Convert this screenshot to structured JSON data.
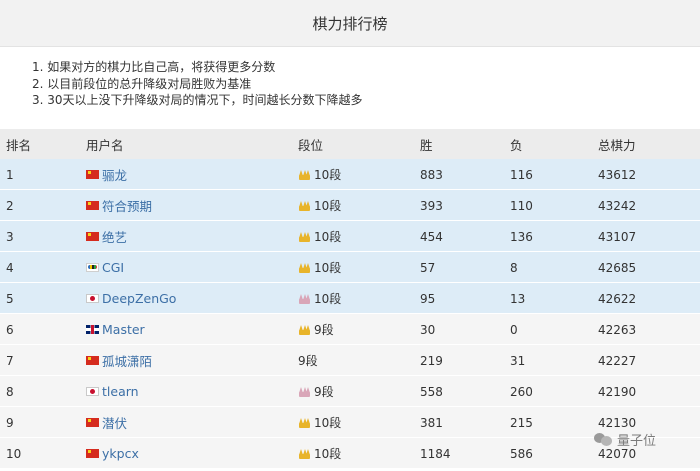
{
  "page": {
    "title": "棋力排行榜"
  },
  "notes": [
    "1. 如果对方的棋力比自己高，将获得更多分数",
    "2. 以目前段位的总升降级对局胜败为基准",
    "3. 30天以上没下升降级对局的情况下，时间越长分数下降越多"
  ],
  "table": {
    "headers": {
      "rank": "排名",
      "user": "用户名",
      "dan": "段位",
      "wins": "胜",
      "losses": "负",
      "total": "总棋力"
    },
    "rows": [
      {
        "rank": "1",
        "flag": "cn",
        "user": "骊龙",
        "crown": "gold",
        "dan": "10段",
        "wins": "883",
        "losses": "116",
        "total": "43612"
      },
      {
        "rank": "2",
        "flag": "cn",
        "user": "符合预期",
        "crown": "gold",
        "dan": "10段",
        "wins": "393",
        "losses": "110",
        "total": "43242"
      },
      {
        "rank": "3",
        "flag": "cn",
        "user": "绝艺",
        "crown": "gold",
        "dan": "10段",
        "wins": "454",
        "losses": "136",
        "total": "43107"
      },
      {
        "rank": "4",
        "flag": "olympic",
        "user": "CGI",
        "crown": "gold",
        "dan": "10段",
        "wins": "57",
        "losses": "8",
        "total": "42685"
      },
      {
        "rank": "5",
        "flag": "jp",
        "user": "DeepZenGo",
        "crown": "pink",
        "dan": "10段",
        "wins": "95",
        "losses": "13",
        "total": "42622"
      },
      {
        "rank": "6",
        "flag": "uk",
        "user": "Master",
        "crown": "gold",
        "dan": "9段",
        "wins": "30",
        "losses": "0",
        "total": "42263"
      },
      {
        "rank": "7",
        "flag": "cn",
        "user": "孤城潇陌",
        "crown": "none",
        "dan": "9段",
        "wins": "219",
        "losses": "31",
        "total": "42227"
      },
      {
        "rank": "8",
        "flag": "jp",
        "user": "tlearn",
        "crown": "pink",
        "dan": "9段",
        "wins": "558",
        "losses": "260",
        "total": "42190"
      },
      {
        "rank": "9",
        "flag": "cn",
        "user": "潜伏",
        "crown": "gold",
        "dan": "10段",
        "wins": "381",
        "losses": "215",
        "total": "42130"
      },
      {
        "rank": "10",
        "flag": "cn",
        "user": "ykpcx",
        "crown": "gold",
        "dan": "10段",
        "wins": "1184",
        "losses": "586",
        "total": "42070"
      }
    ]
  },
  "watermark": {
    "text": "量子位"
  },
  "colors": {
    "highlight_row": "#ddecf7",
    "plain_row": "#f5f5f5",
    "link": "#3c6fa6",
    "header_bg": "#f2f2f2"
  }
}
